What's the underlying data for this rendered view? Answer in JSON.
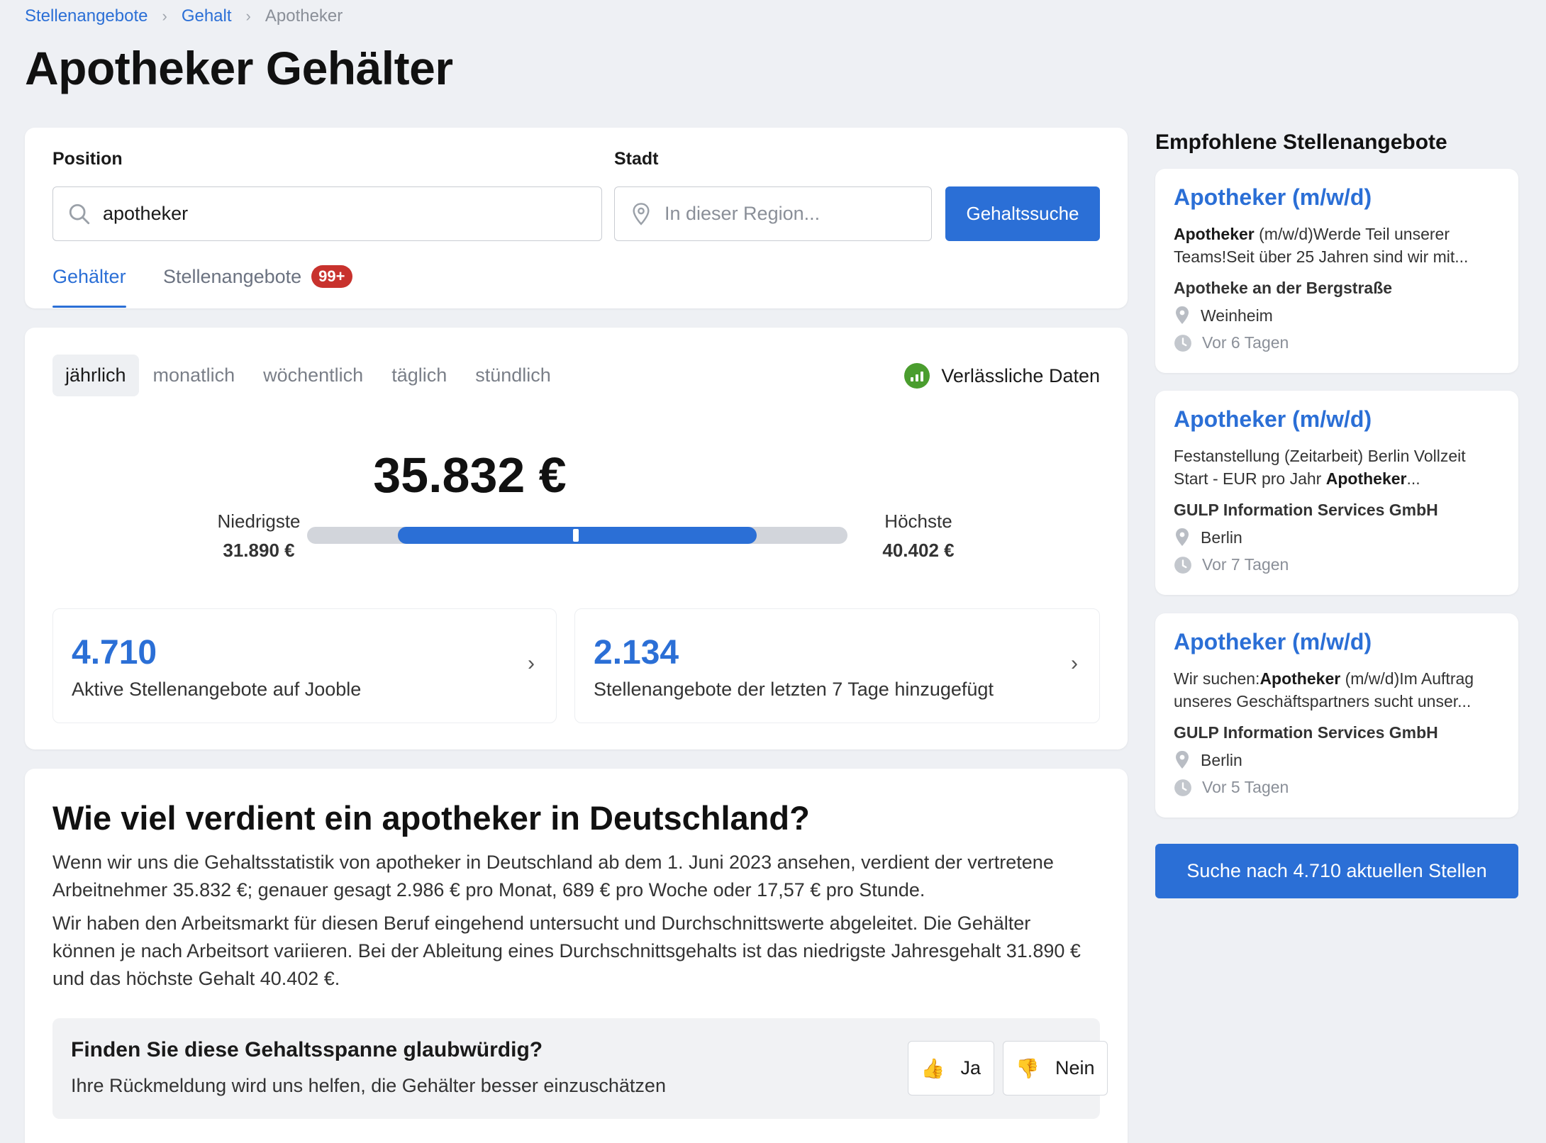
{
  "breadcrumb": {
    "items": [
      "Stellenangebote",
      "Gehalt",
      "Apotheker"
    ]
  },
  "page_title": "Apotheker Gehälter",
  "search": {
    "position_label": "Position",
    "position_value": "apotheker",
    "city_label": "Stadt",
    "city_placeholder": "In dieser Region...",
    "button_label": "Gehaltssuche",
    "icons": {
      "position": "search-icon",
      "city": "location-pin-icon"
    }
  },
  "tabs": [
    {
      "label": "Gehälter",
      "active": true
    },
    {
      "label": "Stellenangebote",
      "badge": "99+",
      "active": false
    }
  ],
  "salary": {
    "periods": [
      "jährlich",
      "monatlich",
      "wöchentlich",
      "täglich",
      "stündlich"
    ],
    "active_period": "jährlich",
    "reliability_label": "Verlässliche Daten",
    "average": "35.832 €",
    "lowest_label": "Niedrigste",
    "lowest_value": "31.890 €",
    "highest_label": "Höchste",
    "highest_value": "40.402 €",
    "stats": [
      {
        "number": "4.710",
        "text": "Aktive Stellenangebote auf Jooble"
      },
      {
        "number": "2.134",
        "text": "Stellenangebote der letzten 7 Tage hinzugefügt"
      }
    ]
  },
  "info": {
    "heading": "Wie viel verdient ein apotheker in Deutschland?",
    "para1_line1": "Wenn wir uns die Gehaltsstatistik von apotheker in Deutschland ab dem 1. Juni 2023 ansehen, verdient der vertretene",
    "para1_line2": "Arbeitnehmer 35.832 €; genauer gesagt 2.986 € pro Monat, 689 € pro Woche oder 17,57 € pro Stunde.",
    "para2_line1": "Wir haben den Arbeitsmarkt für diesen Beruf eingehend untersucht und Durchschnittswerte abgeleitet. Die Gehälter",
    "para2_line2": "können je nach Arbeitsort variieren. Bei der Ableitung eines Durchschnittsgehalts ist das niedrigste Jahresgehalt 31.890 €",
    "para2_line3": "und das höchste Gehalt 40.402 €.",
    "feedback_title": "Finden Sie diese Gehaltsspanne glaubwürdig?",
    "feedback_sub": "Ihre Rückmeldung wird uns helfen, die Gehälter besser einzuschätzen",
    "yes_label": "Ja",
    "no_label": "Nein",
    "yes_icon": "👍",
    "no_icon": "👎"
  },
  "sidebar": {
    "title": "Empfohlene Stellenangebote",
    "jobs": [
      {
        "title": "Apotheker (m/w/d)",
        "snippet_a1": "Apotheker",
        "snippet_b1": " (m/w/d)Werde Teil unserer",
        "snippet_l2": "Teams!Seit über 25 Jahren sind wir mit...",
        "company": "Apotheke an der Bergstraße",
        "location": "Weinheim",
        "posted": "Vor 6 Tagen"
      },
      {
        "title": "Apotheker (m/w/d)",
        "snippet_l1": "Festanstellung (Zeitarbeit) Berlin Vollzeit",
        "snippet_a2": "Start - EUR pro Jahr ",
        "snippet_b2": "Apotheker",
        "snippet_c2": "...",
        "company": "GULP Information Services GmbH",
        "location": "Berlin",
        "posted": "Vor 7 Tagen"
      },
      {
        "title": "Apotheker (m/w/d)",
        "snippet_a1": "Wir suchen:",
        "snippet_b1": "Apotheker",
        "snippet_c1": " (m/w/d)Im Auftrag",
        "snippet_l2": "unseres Geschäftspartners sucht unser...",
        "company": "GULP Information Services GmbH",
        "location": "Berlin",
        "posted": "Vor 5 Tagen"
      }
    ],
    "button_label": "Suche nach 4.710 aktuellen Stellen"
  },
  "colors": {
    "accent": "#2b6fd6",
    "badge": "#c8322d",
    "reliable": "#4a9d2e",
    "background": "#eef0f4"
  }
}
